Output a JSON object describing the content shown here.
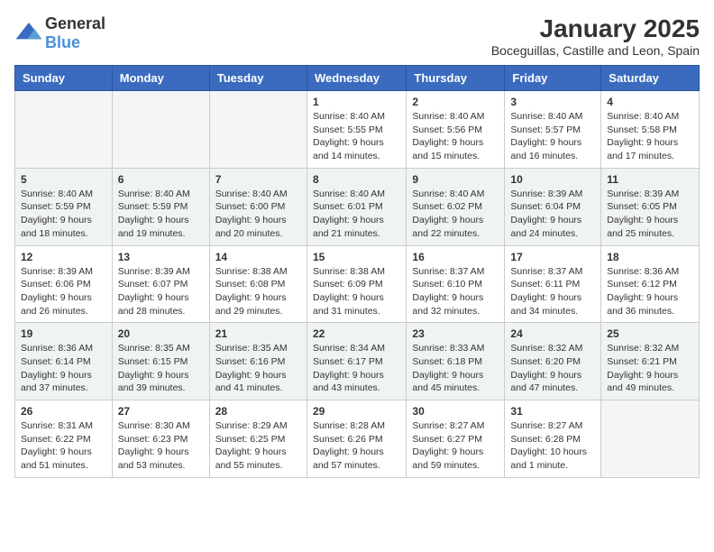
{
  "logo": {
    "general": "General",
    "blue": "Blue"
  },
  "title": "January 2025",
  "subtitle": "Boceguillas, Castille and Leon, Spain",
  "weekdays": [
    "Sunday",
    "Monday",
    "Tuesday",
    "Wednesday",
    "Thursday",
    "Friday",
    "Saturday"
  ],
  "weeks": [
    [
      {
        "day": "",
        "sunrise": "",
        "sunset": "",
        "daylight": ""
      },
      {
        "day": "",
        "sunrise": "",
        "sunset": "",
        "daylight": ""
      },
      {
        "day": "",
        "sunrise": "",
        "sunset": "",
        "daylight": ""
      },
      {
        "day": "1",
        "sunrise": "Sunrise: 8:40 AM",
        "sunset": "Sunset: 5:55 PM",
        "daylight": "Daylight: 9 hours and 14 minutes."
      },
      {
        "day": "2",
        "sunrise": "Sunrise: 8:40 AM",
        "sunset": "Sunset: 5:56 PM",
        "daylight": "Daylight: 9 hours and 15 minutes."
      },
      {
        "day": "3",
        "sunrise": "Sunrise: 8:40 AM",
        "sunset": "Sunset: 5:57 PM",
        "daylight": "Daylight: 9 hours and 16 minutes."
      },
      {
        "day": "4",
        "sunrise": "Sunrise: 8:40 AM",
        "sunset": "Sunset: 5:58 PM",
        "daylight": "Daylight: 9 hours and 17 minutes."
      }
    ],
    [
      {
        "day": "5",
        "sunrise": "Sunrise: 8:40 AM",
        "sunset": "Sunset: 5:59 PM",
        "daylight": "Daylight: 9 hours and 18 minutes."
      },
      {
        "day": "6",
        "sunrise": "Sunrise: 8:40 AM",
        "sunset": "Sunset: 5:59 PM",
        "daylight": "Daylight: 9 hours and 19 minutes."
      },
      {
        "day": "7",
        "sunrise": "Sunrise: 8:40 AM",
        "sunset": "Sunset: 6:00 PM",
        "daylight": "Daylight: 9 hours and 20 minutes."
      },
      {
        "day": "8",
        "sunrise": "Sunrise: 8:40 AM",
        "sunset": "Sunset: 6:01 PM",
        "daylight": "Daylight: 9 hours and 21 minutes."
      },
      {
        "day": "9",
        "sunrise": "Sunrise: 8:40 AM",
        "sunset": "Sunset: 6:02 PM",
        "daylight": "Daylight: 9 hours and 22 minutes."
      },
      {
        "day": "10",
        "sunrise": "Sunrise: 8:39 AM",
        "sunset": "Sunset: 6:04 PM",
        "daylight": "Daylight: 9 hours and 24 minutes."
      },
      {
        "day": "11",
        "sunrise": "Sunrise: 8:39 AM",
        "sunset": "Sunset: 6:05 PM",
        "daylight": "Daylight: 9 hours and 25 minutes."
      }
    ],
    [
      {
        "day": "12",
        "sunrise": "Sunrise: 8:39 AM",
        "sunset": "Sunset: 6:06 PM",
        "daylight": "Daylight: 9 hours and 26 minutes."
      },
      {
        "day": "13",
        "sunrise": "Sunrise: 8:39 AM",
        "sunset": "Sunset: 6:07 PM",
        "daylight": "Daylight: 9 hours and 28 minutes."
      },
      {
        "day": "14",
        "sunrise": "Sunrise: 8:38 AM",
        "sunset": "Sunset: 6:08 PM",
        "daylight": "Daylight: 9 hours and 29 minutes."
      },
      {
        "day": "15",
        "sunrise": "Sunrise: 8:38 AM",
        "sunset": "Sunset: 6:09 PM",
        "daylight": "Daylight: 9 hours and 31 minutes."
      },
      {
        "day": "16",
        "sunrise": "Sunrise: 8:37 AM",
        "sunset": "Sunset: 6:10 PM",
        "daylight": "Daylight: 9 hours and 32 minutes."
      },
      {
        "day": "17",
        "sunrise": "Sunrise: 8:37 AM",
        "sunset": "Sunset: 6:11 PM",
        "daylight": "Daylight: 9 hours and 34 minutes."
      },
      {
        "day": "18",
        "sunrise": "Sunrise: 8:36 AM",
        "sunset": "Sunset: 6:12 PM",
        "daylight": "Daylight: 9 hours and 36 minutes."
      }
    ],
    [
      {
        "day": "19",
        "sunrise": "Sunrise: 8:36 AM",
        "sunset": "Sunset: 6:14 PM",
        "daylight": "Daylight: 9 hours and 37 minutes."
      },
      {
        "day": "20",
        "sunrise": "Sunrise: 8:35 AM",
        "sunset": "Sunset: 6:15 PM",
        "daylight": "Daylight: 9 hours and 39 minutes."
      },
      {
        "day": "21",
        "sunrise": "Sunrise: 8:35 AM",
        "sunset": "Sunset: 6:16 PM",
        "daylight": "Daylight: 9 hours and 41 minutes."
      },
      {
        "day": "22",
        "sunrise": "Sunrise: 8:34 AM",
        "sunset": "Sunset: 6:17 PM",
        "daylight": "Daylight: 9 hours and 43 minutes."
      },
      {
        "day": "23",
        "sunrise": "Sunrise: 8:33 AM",
        "sunset": "Sunset: 6:18 PM",
        "daylight": "Daylight: 9 hours and 45 minutes."
      },
      {
        "day": "24",
        "sunrise": "Sunrise: 8:32 AM",
        "sunset": "Sunset: 6:20 PM",
        "daylight": "Daylight: 9 hours and 47 minutes."
      },
      {
        "day": "25",
        "sunrise": "Sunrise: 8:32 AM",
        "sunset": "Sunset: 6:21 PM",
        "daylight": "Daylight: 9 hours and 49 minutes."
      }
    ],
    [
      {
        "day": "26",
        "sunrise": "Sunrise: 8:31 AM",
        "sunset": "Sunset: 6:22 PM",
        "daylight": "Daylight: 9 hours and 51 minutes."
      },
      {
        "day": "27",
        "sunrise": "Sunrise: 8:30 AM",
        "sunset": "Sunset: 6:23 PM",
        "daylight": "Daylight: 9 hours and 53 minutes."
      },
      {
        "day": "28",
        "sunrise": "Sunrise: 8:29 AM",
        "sunset": "Sunset: 6:25 PM",
        "daylight": "Daylight: 9 hours and 55 minutes."
      },
      {
        "day": "29",
        "sunrise": "Sunrise: 8:28 AM",
        "sunset": "Sunset: 6:26 PM",
        "daylight": "Daylight: 9 hours and 57 minutes."
      },
      {
        "day": "30",
        "sunrise": "Sunrise: 8:27 AM",
        "sunset": "Sunset: 6:27 PM",
        "daylight": "Daylight: 9 hours and 59 minutes."
      },
      {
        "day": "31",
        "sunrise": "Sunrise: 8:27 AM",
        "sunset": "Sunset: 6:28 PM",
        "daylight": "Daylight: 10 hours and 1 minute."
      },
      {
        "day": "",
        "sunrise": "",
        "sunset": "",
        "daylight": ""
      }
    ]
  ]
}
